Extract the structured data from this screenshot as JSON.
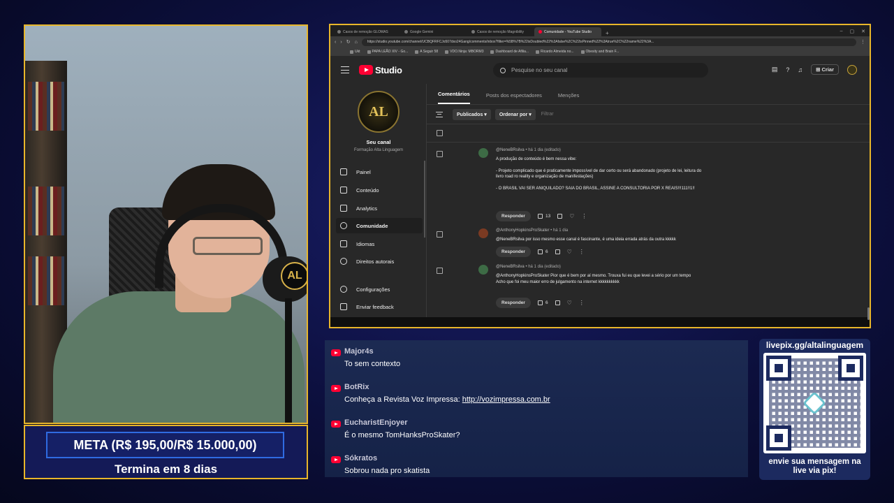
{
  "webcam": {
    "mic_badge": "AL"
  },
  "meta": {
    "title": "META (R$ 195,00/R$ 15.000,00)",
    "subtitle": "Termina em 8 dias"
  },
  "browser": {
    "tabs": [
      {
        "label": "Casos de remoção GLOMAS",
        "active": false
      },
      {
        "label": "Google Gemini",
        "active": false
      },
      {
        "label": "Casos de remoção Magnibility",
        "active": false
      },
      {
        "label": "Comunidade - YouTube Studio",
        "active": true
      }
    ],
    "new_tab": "+",
    "window_controls": [
      "–",
      "▢",
      "✕"
    ],
    "url": "https://studio.youtube.com/channel/UCBQFRFCJo507dxo24Gang/comments/inbox?filter=%5B%7B%22isDoubled%22%3Afalse%2C%22isPinned%22%3Atrue%2C%22name%22%3A...",
    "bookmarks": [
      "Ukt",
      "PAPA LEÃO XIV - Go...",
      "A Seguir 58",
      "VDO.Ninja: MBORM3",
      "Dashboard de Afilia...",
      "Ricardo Almeida no...",
      "Obesity and Brain F..."
    ]
  },
  "studio": {
    "logo_text": "Studio",
    "search_placeholder": "Pesquise no seu canal",
    "create_label": "Criar",
    "channel": {
      "avatar_text": "AL",
      "name": "Seu canal",
      "handle": "Formação Alta Linguagem"
    },
    "nav": [
      {
        "label": "Painel",
        "icon": "dashboard-icon",
        "active": false
      },
      {
        "label": "Conteúdo",
        "icon": "content-icon",
        "active": false
      },
      {
        "label": "Analytics",
        "icon": "analytics-icon",
        "active": false
      },
      {
        "label": "Comunidade",
        "icon": "community-icon",
        "active": true
      },
      {
        "label": "Idiomas",
        "icon": "subtitles-icon",
        "active": false
      },
      {
        "label": "Direitos autorais",
        "icon": "copyright-icon",
        "active": false
      },
      {
        "label": "Configurações",
        "icon": "gear-icon",
        "active": false
      },
      {
        "label": "Enviar feedback",
        "icon": "feedback-icon",
        "active": false
      }
    ],
    "tabs": [
      {
        "label": "Comentários",
        "active": true
      },
      {
        "label": "Posts dos espectadores",
        "active": false
      },
      {
        "label": "Menções",
        "active": false
      }
    ],
    "filters": {
      "published": "Publicados",
      "sort": "Ordenar por",
      "filter_placeholder": "Filtrar"
    },
    "reply_label": "Responder",
    "comments": [
      {
        "author": "@NeneBRsilva",
        "time": "há 1 dia (editado)",
        "lines": [
          "A produção de conteúdo é bem nessa vibe:",
          "",
          "- Projeto complicado que é praticamente impossível de dar certo ou será abandonado (projeto de lei, leitura do livro road ro reality e organização de manifestações)",
          "",
          "- O BRASIL VAI SER ANIQUILADO? SAIA DO BRASIL, ASSINE A CONSULTORIA POR X REAIS!!!111!!1!!"
        ],
        "likes": "13",
        "avatar_color": "#3d6b45"
      },
      {
        "author": "@AnthonyHopkinsProSkater",
        "time": "há 1 dia",
        "lines": [
          "@NeneBRsilva por isso mesmo esse canal é fascinante, é uma ideia errada atrás da outra kkkkk"
        ],
        "likes": "6",
        "avatar_color": "#7a3a22"
      },
      {
        "author": "@NeneBRsilva",
        "time": "há 1 dia (editado)",
        "lines": [
          "@AnthonyHopkinsProSkater Pior que é bem por aí mesmo. Trouxa fui eu que levei a sério por um tempo",
          "Acho que foi meu maior erro de julgamento na internet kkkkkkkkkk"
        ],
        "likes": "6",
        "avatar_color": "#3d6b45"
      }
    ]
  },
  "chat": {
    "messages": [
      {
        "author": "Major4s",
        "text": "To sem contexto"
      },
      {
        "author": "BotRix",
        "text": "Conheça a Revista Voz Impressa: ",
        "link": "http://vozimpressa.com.br"
      },
      {
        "author": "EucharistEnjoyer",
        "text": "É o mesmo TomHanksProSkater?"
      },
      {
        "author": "Sókratos",
        "text": "Sobrou nada pro skatista"
      }
    ]
  },
  "pix": {
    "url": "livepix.gg/altalinguagem",
    "message_line1": "envie sua mensagem na",
    "message_line2": "live via pix!"
  }
}
